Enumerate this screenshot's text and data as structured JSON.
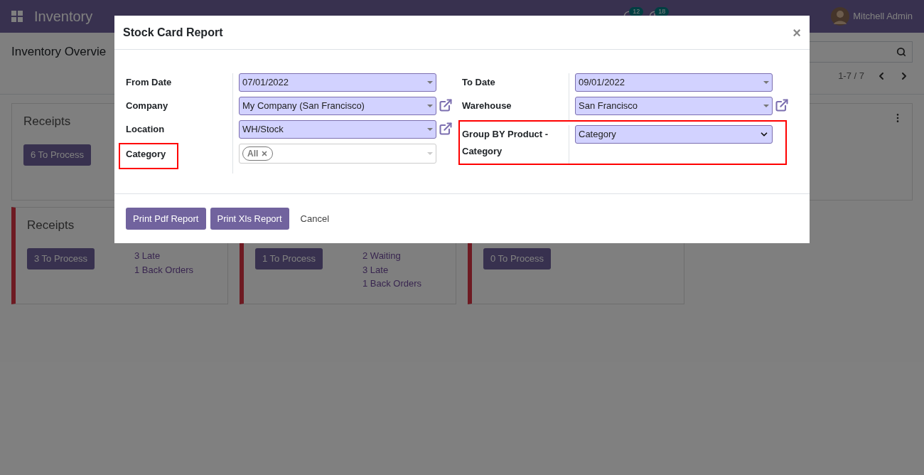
{
  "navbar": {
    "app_name": "Inventory",
    "badges": [
      {
        "kind": "chat",
        "count": "12"
      },
      {
        "kind": "activity",
        "count": "18"
      }
    ],
    "user": "Mitchell Admin"
  },
  "control_panel": {
    "title": "Inventory Overvie",
    "pager": "1-7 / 7"
  },
  "card_rows": [
    [
      {
        "title": "Receipts",
        "button": "6 To Process",
        "alert": false
      },
      {},
      {},
      {
        "alert": false,
        "menu": true
      }
    ],
    [
      {
        "title": "Receipts",
        "button": "3 To Process",
        "stats": [
          "3 Late",
          "1 Back Orders"
        ],
        "alert": true
      },
      {
        "button": "1 To Process",
        "stats": [
          "2 Waiting",
          "3 Late",
          "1 Back Orders"
        ],
        "alert": true
      },
      {
        "button": "0 To Process",
        "alert": true
      }
    ]
  ],
  "dialog": {
    "title": "Stock Card Report",
    "close": "×",
    "left_fields": [
      {
        "label": "From Date",
        "kind": "date",
        "value": "07/01/2022",
        "external_link": false,
        "label_highlighted": false,
        "row_highlighted": false
      },
      {
        "label": "Company",
        "kind": "many2one",
        "value": "My Company (San Francisco)",
        "external_link": true,
        "label_highlighted": false,
        "row_highlighted": false
      },
      {
        "label": "Location",
        "kind": "many2one",
        "value": "WH/Stock",
        "external_link": true,
        "label_highlighted": false,
        "row_highlighted": false
      },
      {
        "label": "Category",
        "kind": "tags",
        "tags": [
          "All"
        ],
        "external_link": false,
        "label_highlighted": true,
        "row_highlighted": false
      }
    ],
    "right_fields": [
      {
        "label": "To Date",
        "kind": "date",
        "value": "09/01/2022",
        "external_link": false,
        "label_highlighted": false,
        "row_highlighted": false
      },
      {
        "label": "Warehouse",
        "kind": "many2one",
        "value": "San Francisco",
        "external_link": true,
        "label_highlighted": false,
        "row_highlighted": false
      },
      {
        "label": "Group BY Product - Category",
        "kind": "select",
        "value": "Category",
        "external_link": false,
        "label_highlighted": false,
        "row_highlighted": true
      }
    ],
    "buttons": [
      {
        "label": "Print Pdf Report",
        "kind": "primary"
      },
      {
        "label": "Print Xls Report",
        "kind": "primary"
      },
      {
        "label": "Cancel",
        "kind": "link"
      }
    ]
  }
}
